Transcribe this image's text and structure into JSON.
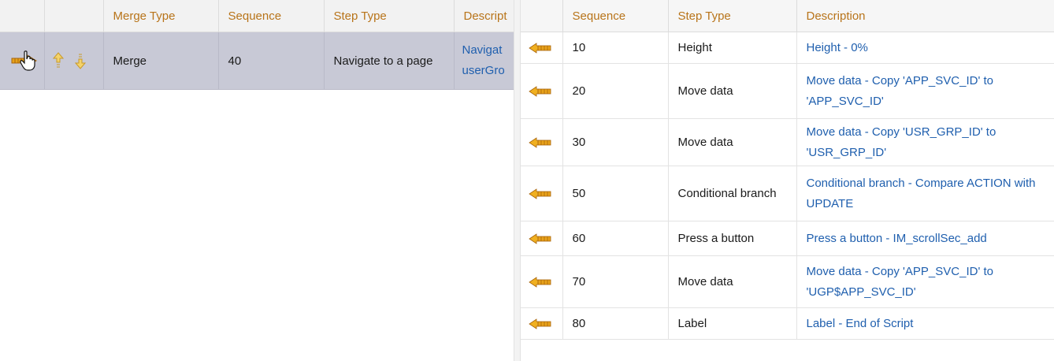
{
  "left_table": {
    "headers": [
      "Merge Type",
      "Sequence",
      "Step Type",
      "Descript"
    ],
    "row": {
      "merge_type": "Merge",
      "sequence": "40",
      "step_type": "Navigate to a page",
      "description_line1": "Navigat",
      "description_line2": "userGro"
    }
  },
  "right_table": {
    "headers": [
      "Sequence",
      "Step Type",
      "Description"
    ],
    "rows": [
      {
        "sequence": "10",
        "step_type": "Height",
        "description": "Height - 0%"
      },
      {
        "sequence": "20",
        "step_type": "Move data",
        "description": "Move data - Copy 'APP_SVC_ID' to 'APP_SVC_ID'"
      },
      {
        "sequence": "30",
        "step_type": "Move data",
        "description": "Move data - Copy 'USR_GRP_ID' to 'USR_GRP_ID'"
      },
      {
        "sequence": "50",
        "step_type": "Conditional branch",
        "description": "Conditional branch - Compare ACTION with UPDATE"
      },
      {
        "sequence": "60",
        "step_type": "Press a button",
        "description": "Press a button - IM_scrollSec_add"
      },
      {
        "sequence": "70",
        "step_type": "Move data",
        "description": "Move data - Copy 'APP_SVC_ID' to 'UGP$APP_SVC_ID'"
      },
      {
        "sequence": "80",
        "step_type": "Label",
        "description": "Label - End of Script"
      }
    ]
  },
  "colors": {
    "header_text": "#b8741a",
    "link_text": "#1f5fae",
    "selected_row": "#c8c9d6",
    "arrow_icon": "#e8a21a"
  }
}
